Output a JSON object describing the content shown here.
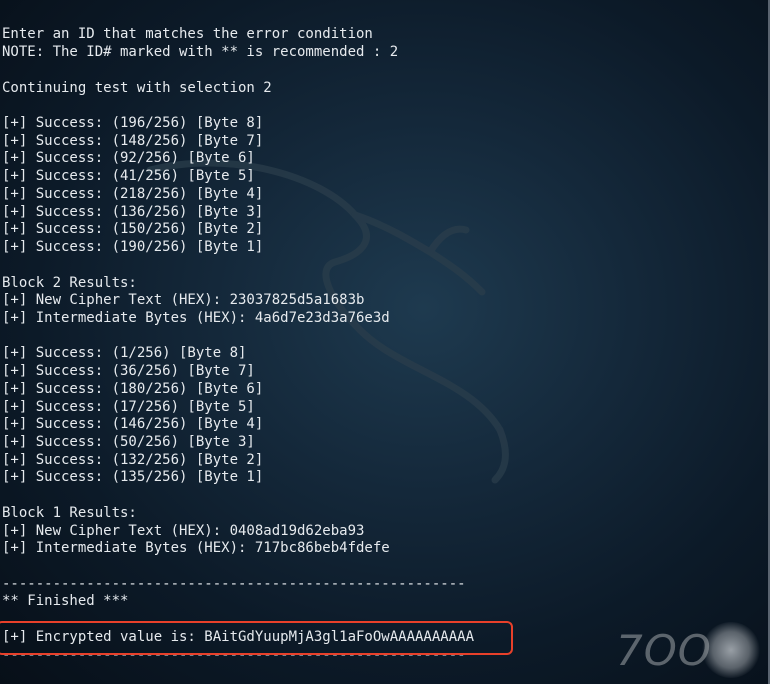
{
  "terminal": {
    "lines": [
      "-------------------------------------------------------",
      "",
      "Enter an ID that matches the error condition",
      "NOTE: The ID# marked with ** is recommended : 2",
      "",
      "Continuing test with selection 2",
      "",
      "[+] Success: (196/256) [Byte 8]",
      "[+] Success: (148/256) [Byte 7]",
      "[+] Success: (92/256) [Byte 6]",
      "[+] Success: (41/256) [Byte 5]",
      "[+] Success: (218/256) [Byte 4]",
      "[+] Success: (136/256) [Byte 3]",
      "[+] Success: (150/256) [Byte 2]",
      "[+] Success: (190/256) [Byte 1]",
      "",
      "Block 2 Results:",
      "[+] New Cipher Text (HEX): 23037825d5a1683b",
      "[+] Intermediate Bytes (HEX): 4a6d7e23d3a76e3d",
      "",
      "[+] Success: (1/256) [Byte 8]",
      "[+] Success: (36/256) [Byte 7]",
      "[+] Success: (180/256) [Byte 6]",
      "[+] Success: (17/256) [Byte 5]",
      "[+] Success: (146/256) [Byte 4]",
      "[+] Success: (50/256) [Byte 3]",
      "[+] Success: (132/256) [Byte 2]",
      "[+] Success: (135/256) [Byte 1]",
      "",
      "Block 1 Results:",
      "[+] New Cipher Text (HEX): 0408ad19d62eba93",
      "[+] Intermediate Bytes (HEX): 717bc86beb4fdefe",
      "",
      "-------------------------------------------------------",
      "** Finished ***",
      "",
      "[+] Encrypted value is: BAitGdYuupMjA3gl1aFoOwAAAAAAAAAA",
      "-------------------------------------------------------"
    ]
  },
  "watermark": {
    "text": "7OO"
  },
  "colors": {
    "terminal_text": "#e6eaee",
    "highlight_border": "#e8402a",
    "background": "#14283a"
  }
}
